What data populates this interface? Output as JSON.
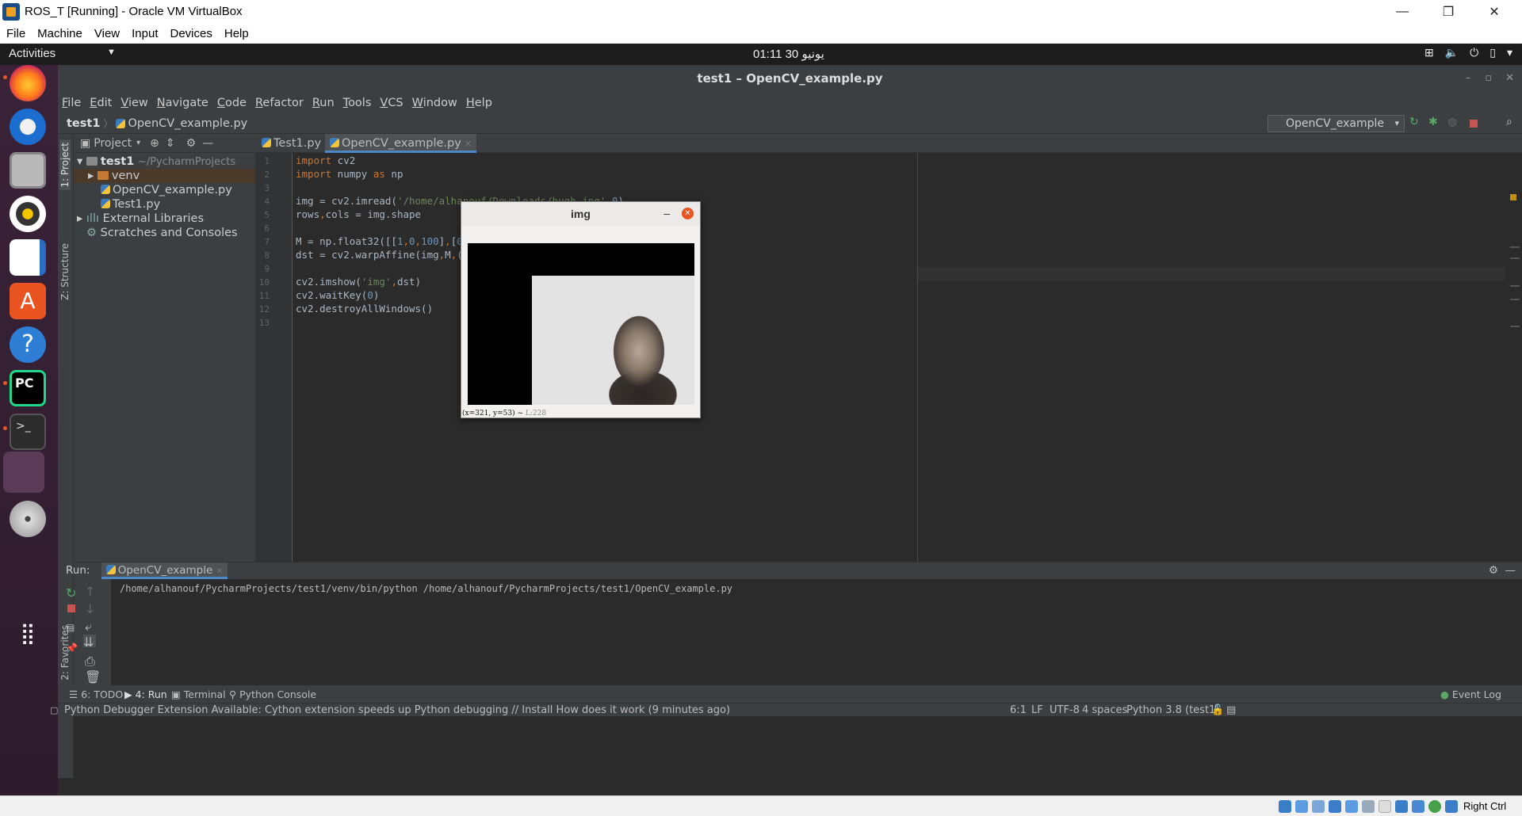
{
  "vbox": {
    "title": "ROS_T [Running] - Oracle VM VirtualBox",
    "menu": [
      "File",
      "Machine",
      "View",
      "Input",
      "Devices",
      "Help"
    ],
    "host_key": "Right Ctrl"
  },
  "gnome": {
    "activities": "Activities",
    "clock": "01:11  30 يونيو"
  },
  "dock": {
    "items": [
      "firefox-icon",
      "thunderbird-icon",
      "files-icon",
      "rhythmbox-icon",
      "writer-icon",
      "software-icon",
      "help-icon",
      "pycharm-icon",
      "terminal-icon",
      "active-app-icon",
      "dvd-icon",
      "show-apps-icon"
    ]
  },
  "pycharm": {
    "window_title": "test1 – OpenCV_example.py",
    "menu": [
      "File",
      "Edit",
      "View",
      "Navigate",
      "Code",
      "Refactor",
      "Run",
      "Tools",
      "VCS",
      "Window",
      "Help"
    ],
    "breadcrumb": {
      "project": "test1",
      "file": "OpenCV_example.py"
    },
    "run_config": "OpenCV_example",
    "project_panel": {
      "label": "Project",
      "tree": [
        {
          "name": "test1",
          "suffix": "~/PycharmProjects",
          "level": 0
        },
        {
          "name": "venv",
          "level": 1
        },
        {
          "name": "OpenCV_example.py",
          "level": 2
        },
        {
          "name": "Test1.py",
          "level": 2
        },
        {
          "name": "External Libraries",
          "level": 0
        },
        {
          "name": "Scratches and Consoles",
          "level": 0
        }
      ]
    },
    "side_tabs": {
      "project": "1: Project",
      "structure": "Z: Structure",
      "favorites": "2: Favorites"
    },
    "editor_tabs": [
      {
        "name": "Test1.py",
        "active": false
      },
      {
        "name": "OpenCV_example.py",
        "active": true
      }
    ],
    "line_numbers": [
      "1",
      "2",
      "3",
      "4",
      "5",
      "6",
      "7",
      "8",
      "9",
      "10",
      "11",
      "12",
      "13"
    ],
    "code_lines": [
      "import cv2",
      "import numpy as np",
      "",
      "img = cv2.imread('/home/alhanouf/Downloads/hugh.jpg',0)",
      "rows,cols = img.shape",
      "",
      "M = np.float32([[1,0,100],[0,1,50]])",
      "dst = cv2.warpAffine(img,M,(cols,rows))",
      "",
      "cv2.imshow('img',dst)",
      "cv2.waitKey(0)",
      "cv2.destroyAllWindows()",
      ""
    ],
    "run": {
      "label": "Run:",
      "config": "OpenCV_example",
      "output": "/home/alhanouf/PycharmProjects/test1/venv/bin/python /home/alhanouf/PycharmProjects/test1/OpenCV_example.py"
    },
    "bottom_tabs": {
      "todo": "6: TODO",
      "run": "4: Run",
      "terminal": "Terminal",
      "console": "Python Console",
      "event_log": "Event Log"
    },
    "status": {
      "message": "Python Debugger Extension Available: Cython extension speeds up Python debugging // Install  How does it work (9 minutes ago)",
      "pos": "6:1",
      "eol": "LF",
      "enc": "UTF-8",
      "indent": "4 spaces",
      "interp": "Python 3.8 (test1)"
    }
  },
  "img_window": {
    "title": "img",
    "status": "(x=321, y=53) ~",
    "status_val": "L:228"
  }
}
